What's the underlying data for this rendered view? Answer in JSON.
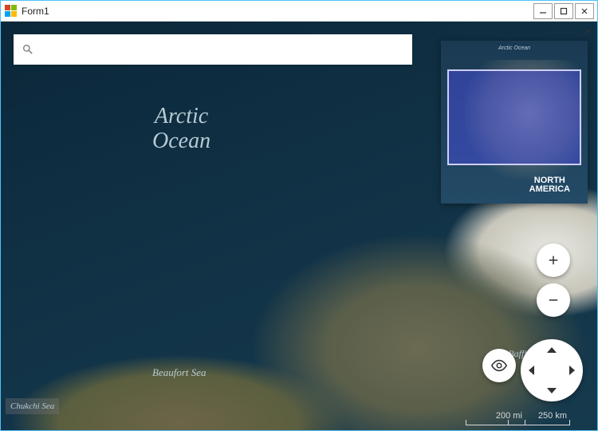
{
  "window": {
    "title": "Form1"
  },
  "search": {
    "placeholder": ""
  },
  "map": {
    "main_label_line1": "Arctic",
    "main_label_line2": "Ocean",
    "beaufort": "Beaufort Sea",
    "chukchi": "Chukchi Sea",
    "baffin": "Baffin B"
  },
  "minimap": {
    "top_label": "Arctic Ocean",
    "na_line1": "NORTH",
    "na_line2": "AMERICA"
  },
  "controls": {
    "zoom_in": "+",
    "zoom_out": "−"
  },
  "scale": {
    "miles": "200 mi",
    "km": "250 km"
  }
}
